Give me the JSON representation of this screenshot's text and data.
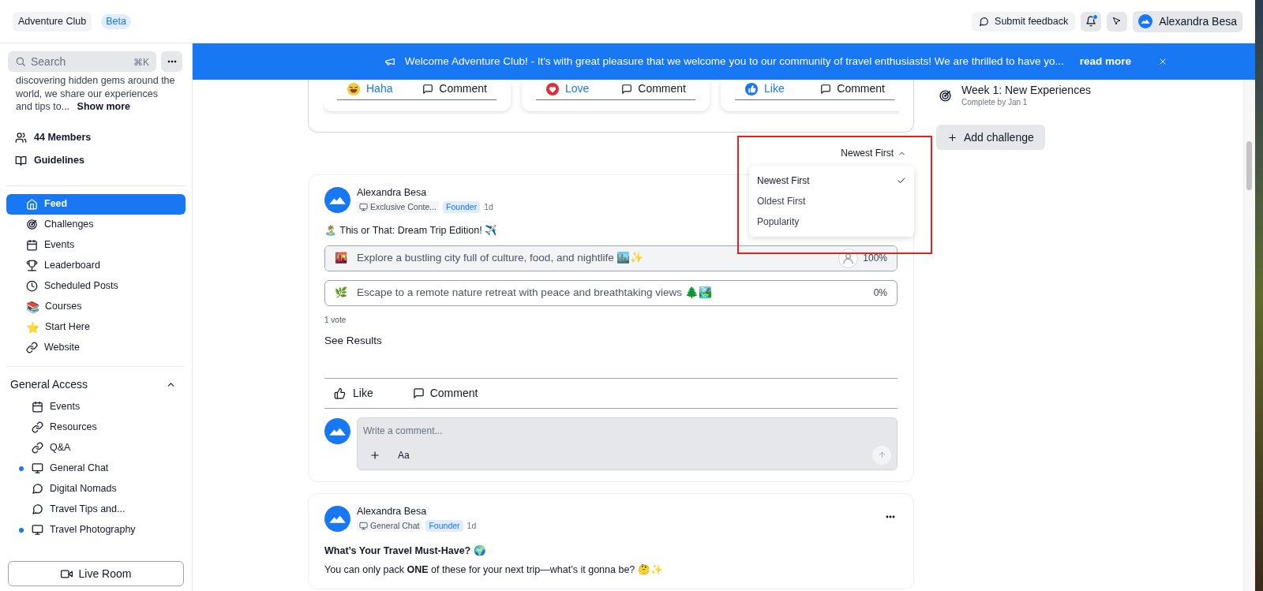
{
  "top_bar": {
    "community": "Adventure Club",
    "badge": "Beta",
    "feedback_button": "Submit feedback",
    "notifications": {
      "unread": true
    },
    "user": "Alexandra Besa"
  },
  "banner": {
    "text": "Welcome Adventure Club! - It's with great pleasure that we welcome you to our community of travel enthusiasts! We are thrilled to have yo...",
    "link": "read more"
  },
  "sidebar": {
    "search": {
      "placeholder": "Search",
      "shortcut": "⌘K"
    },
    "description": "discovering hidden gems around the world, we share our experiences and tips to...",
    "show_more": "Show more",
    "links": [
      {
        "kind": "members",
        "label": "44 Members"
      },
      {
        "kind": "book",
        "label": "Guidelines"
      }
    ],
    "nav": [
      {
        "kind": "home",
        "label": "Feed",
        "selected": true
      },
      {
        "kind": "target",
        "label": "Challenges",
        "selected": false
      },
      {
        "kind": "calendar",
        "label": "Events",
        "selected": false
      },
      {
        "kind": "trophy",
        "label": "Leaderboard",
        "selected": false
      },
      {
        "kind": "clock",
        "label": "Scheduled Posts",
        "selected": false
      },
      {
        "kind": "emoji",
        "emoji": "📚",
        "label": "Courses",
        "selected": false
      },
      {
        "kind": "emoji",
        "emoji": "⭐",
        "label": "Start Here",
        "selected": false
      },
      {
        "kind": "link",
        "label": "Website",
        "selected": false
      }
    ],
    "section": {
      "title": "General Access",
      "expanded": true,
      "items": [
        {
          "kind": "calendar",
          "label": "Events",
          "unread": false
        },
        {
          "kind": "link",
          "label": "Resources",
          "unread": false
        },
        {
          "kind": "link",
          "label": "Q&A",
          "unread": false
        },
        {
          "kind": "monitor",
          "label": "General Chat",
          "unread": true
        },
        {
          "kind": "chat",
          "label": "Digital Nomads",
          "unread": false
        },
        {
          "kind": "chat",
          "label": "Travel Tips and...",
          "unread": false
        },
        {
          "kind": "monitor",
          "label": "Travel Photography",
          "unread": true
        }
      ]
    },
    "live_room": "Live Room"
  },
  "feed": {
    "reaction_cards": [
      {
        "kind": "haha",
        "reaction": "Haha",
        "comment": "Comment"
      },
      {
        "kind": "love",
        "reaction": "Love",
        "comment": "Comment"
      },
      {
        "kind": "like",
        "reaction": "Like",
        "comment": "Comment"
      }
    ],
    "sort": {
      "label": "Newest First",
      "expanded": true,
      "options": [
        {
          "label": "Newest First",
          "selected": true
        },
        {
          "label": "Oldest First",
          "selected": false
        },
        {
          "label": "Popularity",
          "selected": false
        }
      ]
    },
    "posts": [
      {
        "kind": "poll",
        "author": "Alexandra Besa",
        "channel": "Exclusive Conte...",
        "role": "Founder",
        "time": "1d",
        "title": "🏝️ This or That: Dream Trip Edition! ✈️",
        "options": [
          {
            "emoji": "🌇",
            "text": "Explore a bustling city full of culture, food, and nightlife 🏙️✨",
            "percent": "100%",
            "level": 1,
            "voted": true
          },
          {
            "emoji": "🌿",
            "text": "Escape to a remote nature retreat with peace and breathtaking views 🌲🏞️",
            "percent": "0%",
            "level": 0,
            "voted": false
          }
        ],
        "votes": "1 vote",
        "see_results": "See Results",
        "actions": [
          "Like",
          "Comment"
        ],
        "comment": {
          "placeholder": "Write a comment...",
          "format": "Aa"
        }
      },
      {
        "kind": "text",
        "author": "Alexandra Besa",
        "channel": "General Chat",
        "role": "Founder",
        "time": "1d",
        "title": "What’s Your Travel Must-Have? 🌍",
        "body": "You can only pack **ONE** of these for your next trip—what’s it gonna be? 🤔✨"
      }
    ]
  },
  "challenges": {
    "items": [
      {
        "title": "Week 1: New Experiences",
        "due": "Complete by Jan 1"
      }
    ],
    "add_button": "Add challenge"
  }
}
